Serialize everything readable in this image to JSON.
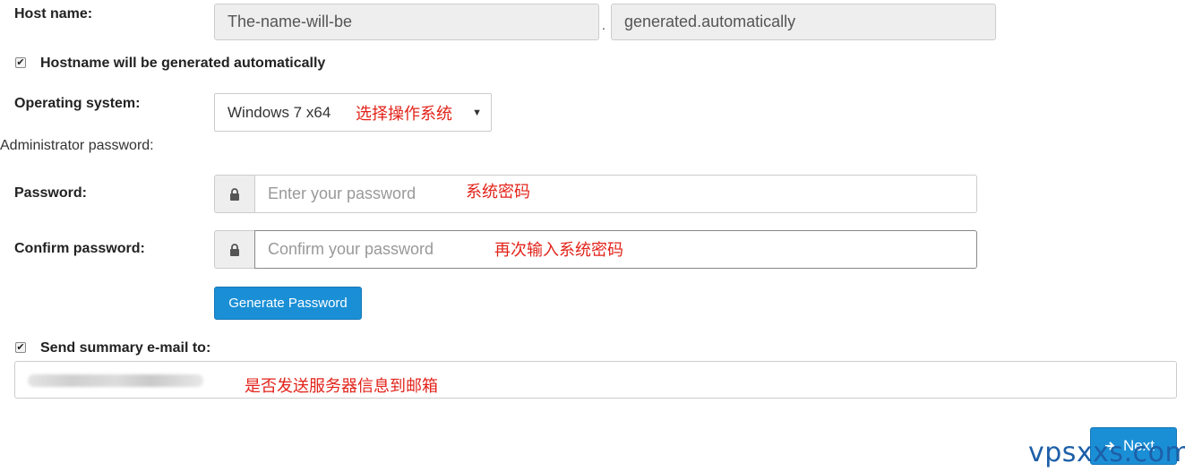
{
  "host": {
    "label": "Host name:",
    "name_value": "The-name-will-be",
    "separator": ".",
    "domain_value": "generated.automatically",
    "auto_checked": true,
    "auto_label": "Hostname will be generated automatically"
  },
  "os": {
    "label": "Operating system:",
    "selected": "Windows 7 x64",
    "annotation": "选择操作系统"
  },
  "admin": {
    "section_label": "Administrator password:",
    "password_label": "Password:",
    "password_placeholder": "Enter your password",
    "password_annotation": "系统密码",
    "confirm_label": "Confirm password:",
    "confirm_placeholder": "Confirm your password",
    "confirm_annotation": "再次输入系统密码",
    "generate_button": "Generate Password"
  },
  "summary": {
    "checked": true,
    "label": "Send summary e-mail to:",
    "annotation": "是否发送服务器信息到邮箱"
  },
  "footer": {
    "next_label": "Next",
    "watermark": "vpsxxs.com"
  },
  "icons": {
    "checkbox_check": "checkmark-icon",
    "lock": "lock-icon",
    "caret": "caret-down-icon",
    "next_arrow": "arrow-right-icon"
  },
  "colors": {
    "primary_button": "#1a8fd6",
    "annotation_red": "#e2231a",
    "readonly_bg": "#eeeeee",
    "watermark_blue": "#1d5fa8"
  }
}
